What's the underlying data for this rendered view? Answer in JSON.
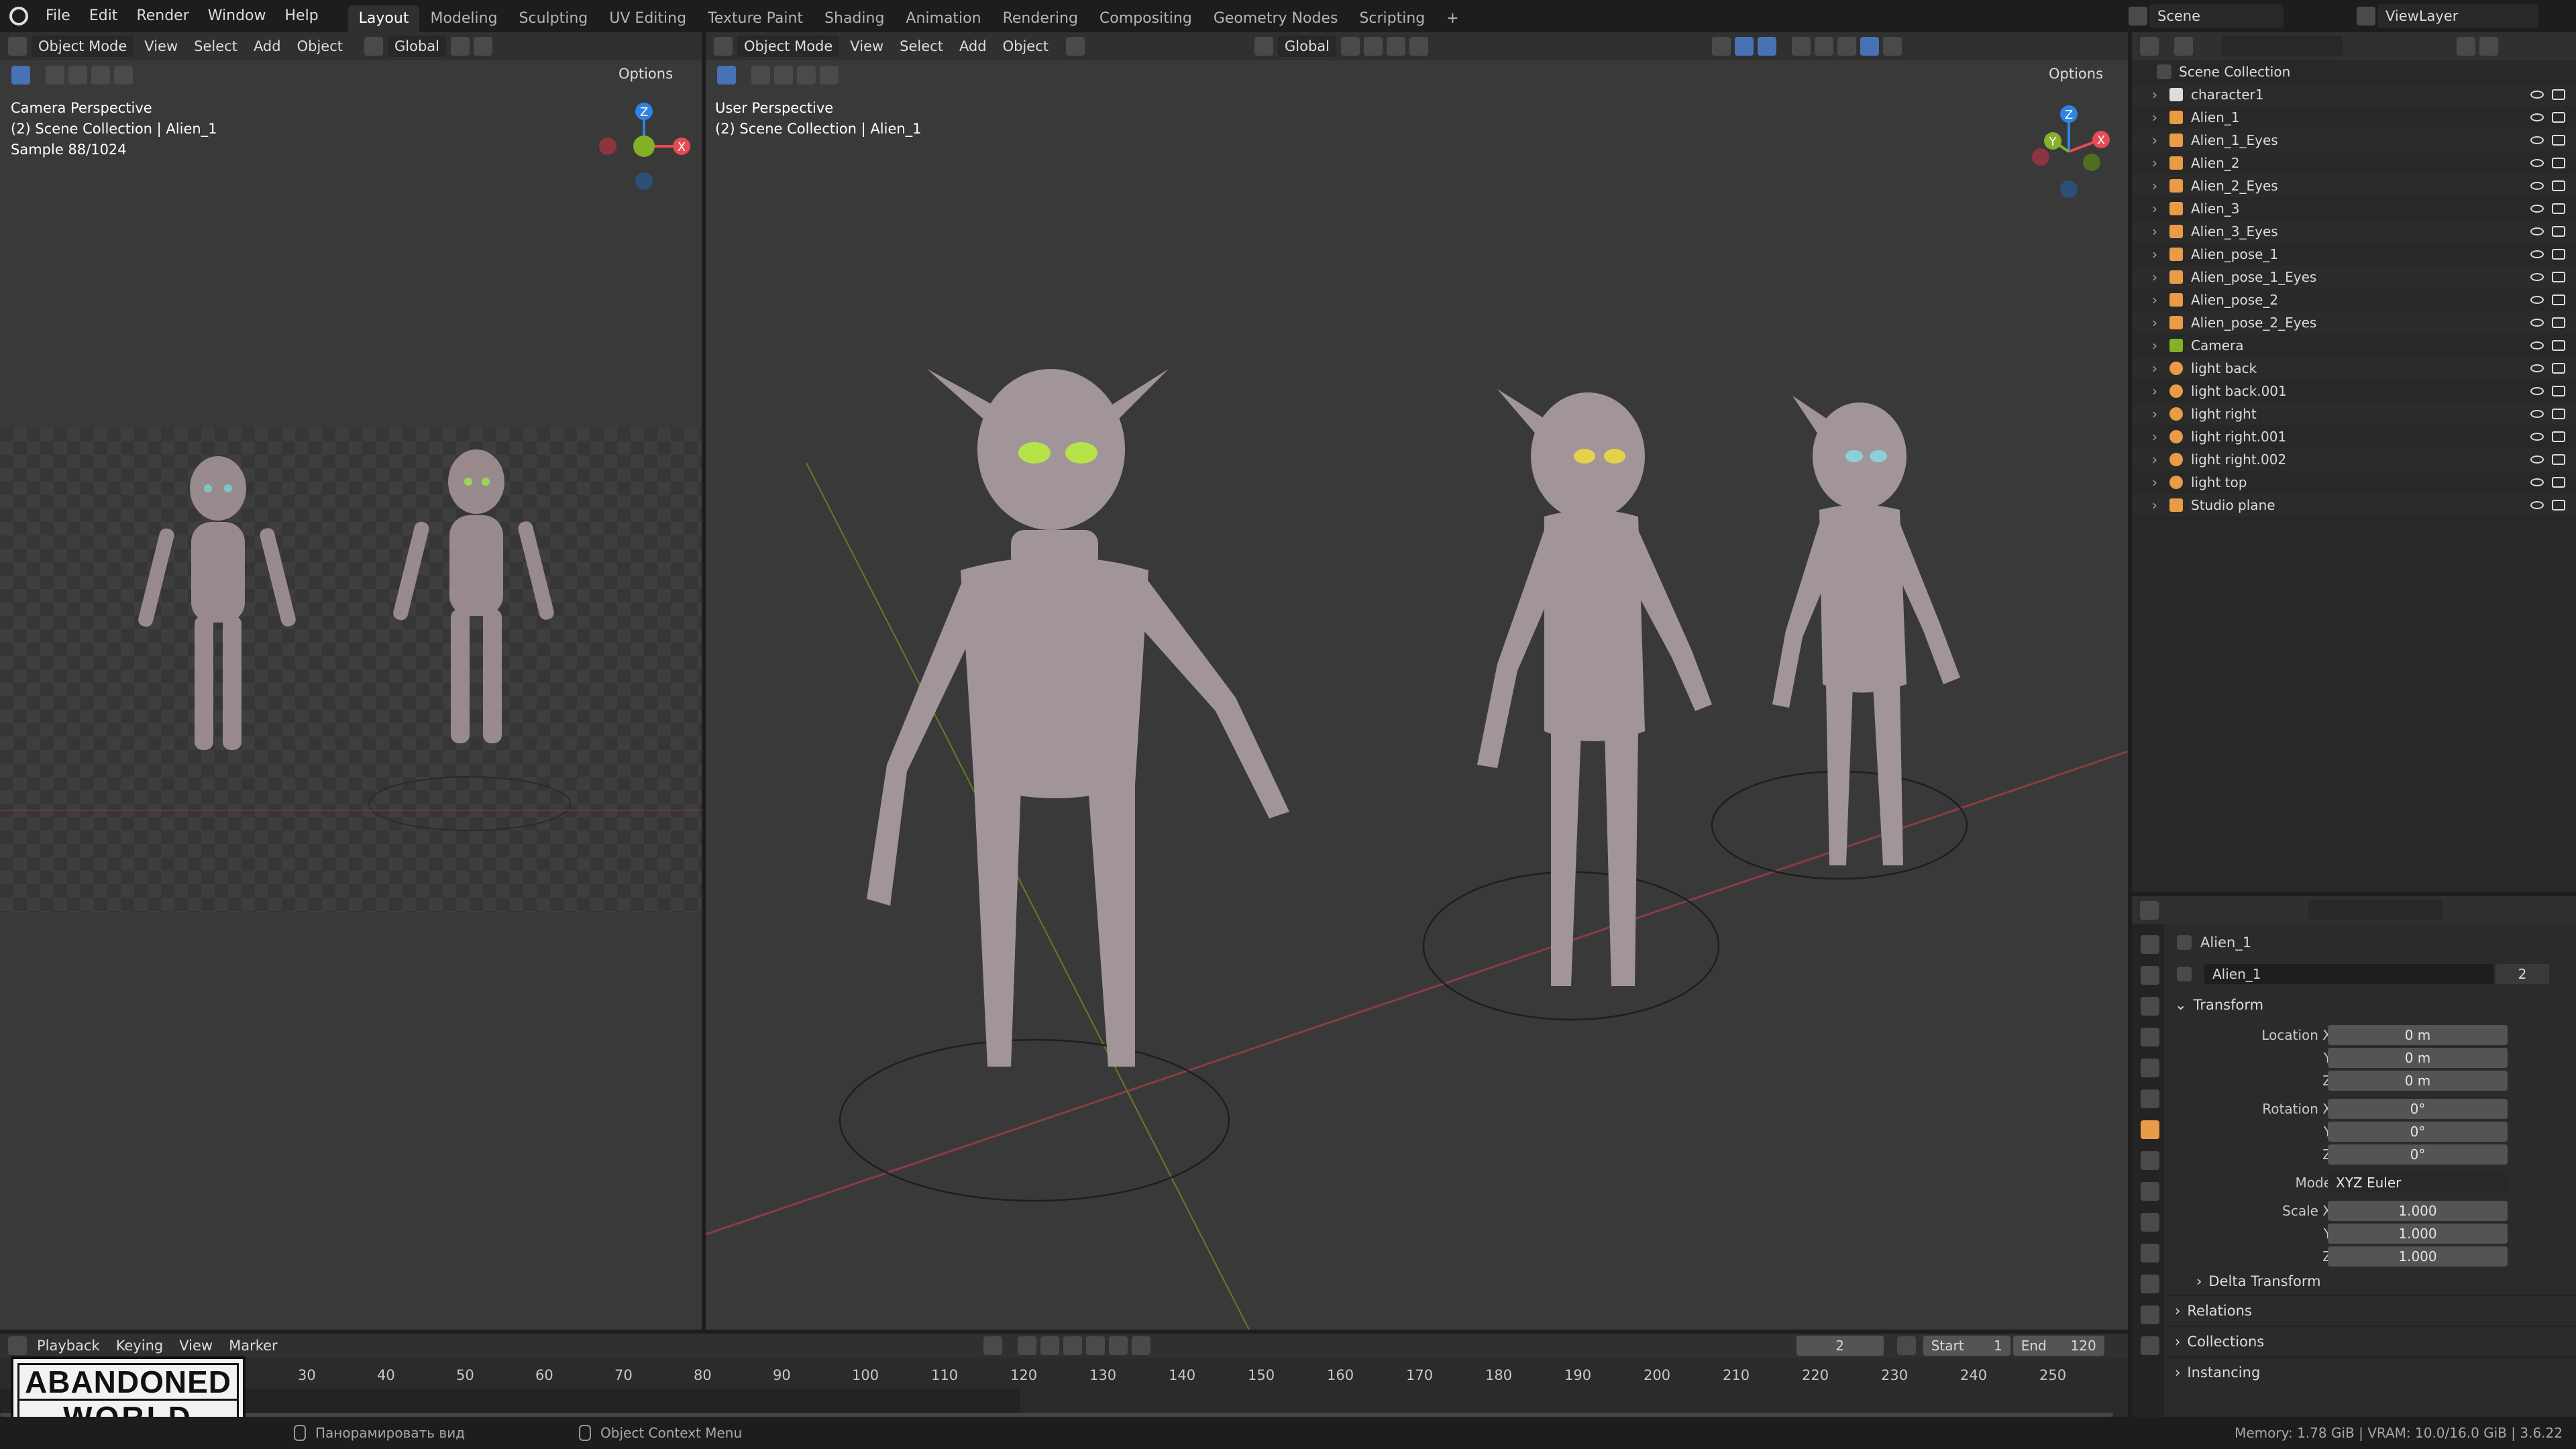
{
  "topbar": {
    "menus": [
      "File",
      "Edit",
      "Render",
      "Window",
      "Help"
    ],
    "workspaces": [
      "Layout",
      "Modeling",
      "Sculpting",
      "UV Editing",
      "Texture Paint",
      "Shading",
      "Animation",
      "Rendering",
      "Compositing",
      "Geometry Nodes",
      "Scripting"
    ],
    "active_workspace": "Layout",
    "add_tab": "+",
    "scene_label": "Scene",
    "viewlayer_label": "ViewLayer"
  },
  "left_view": {
    "mode": "Object Mode",
    "menus": [
      "View",
      "Select",
      "Add",
      "Object"
    ],
    "orientation": "Global",
    "options": "Options",
    "overlay_lines": [
      "Camera Perspective",
      "(2) Scene Collection | Alien_1",
      "Sample 88/1024"
    ]
  },
  "main_view": {
    "mode": "Object Mode",
    "menus": [
      "View",
      "Select",
      "Add",
      "Object"
    ],
    "orientation": "Global",
    "options": "Options",
    "overlay_lines": [
      "User Perspective",
      "(2) Scene Collection | Alien_1"
    ]
  },
  "gizmo_axes": {
    "x": "X",
    "y": "Y",
    "z": "Z"
  },
  "colors": {
    "x_axis": "#e44b55",
    "y_axis": "#84b128",
    "z_axis": "#2f83e3",
    "selected": "#4772b3",
    "object_orange": "#e99b46"
  },
  "outliner": {
    "root": "Scene Collection",
    "items": [
      {
        "name": "character1",
        "icon": "collection-icon"
      },
      {
        "name": "Alien_1",
        "icon": "mesh-icon"
      },
      {
        "name": "Alien_1_Eyes",
        "icon": "mesh-icon"
      },
      {
        "name": "Alien_2",
        "icon": "mesh-icon"
      },
      {
        "name": "Alien_2_Eyes",
        "icon": "mesh-icon"
      },
      {
        "name": "Alien_3",
        "icon": "mesh-icon"
      },
      {
        "name": "Alien_3_Eyes",
        "icon": "mesh-icon"
      },
      {
        "name": "Alien_pose_1",
        "icon": "mesh-icon"
      },
      {
        "name": "Alien_pose_1_Eyes",
        "icon": "mesh-icon"
      },
      {
        "name": "Alien_pose_2",
        "icon": "mesh-icon"
      },
      {
        "name": "Alien_pose_2_Eyes",
        "icon": "mesh-icon"
      },
      {
        "name": "Camera",
        "icon": "camera-icon"
      },
      {
        "name": "light back",
        "icon": "light-icon"
      },
      {
        "name": "light back.001",
        "icon": "light-icon"
      },
      {
        "name": "light right",
        "icon": "light-icon"
      },
      {
        "name": "light right.001",
        "icon": "light-icon"
      },
      {
        "name": "light right.002",
        "icon": "light-icon"
      },
      {
        "name": "light top",
        "icon": "light-icon"
      },
      {
        "name": "Studio plane",
        "icon": "mesh-icon"
      }
    ]
  },
  "properties": {
    "object_name": "Alien_1",
    "datablock_name": "Alien_1",
    "users": "2",
    "transform_label": "Transform",
    "location_label": "Location X",
    "rotation_label": "Rotation X",
    "scale_label": "Scale X",
    "axis_y": "Y",
    "axis_z": "Z",
    "location": [
      "0 m",
      "0 m",
      "0 m"
    ],
    "rotation": [
      "0°",
      "0°",
      "0°"
    ],
    "mode_label": "Mode",
    "mode_value": "XYZ Euler",
    "scale": [
      "1.000",
      "1.000",
      "1.000"
    ],
    "panels": [
      "Delta Transform",
      "Relations",
      "Collections",
      "Instancing"
    ]
  },
  "timeline": {
    "menus": [
      "Playback",
      "Keying",
      "View",
      "Marker"
    ],
    "current_frame": "2",
    "start_label": "Start",
    "start": "1",
    "end_label": "End",
    "end": "120",
    "ticks": [
      "30",
      "40",
      "50",
      "60",
      "70",
      "80",
      "90",
      "100",
      "110",
      "120",
      "130",
      "140",
      "150",
      "160",
      "170",
      "180",
      "190",
      "200",
      "210",
      "220",
      "230",
      "240",
      "250"
    ]
  },
  "statusbar": {
    "hint1": "Панорамировать вид",
    "hint2": "Object Context Menu",
    "stats": "Memory: 1.78 GiB | VRAM: 10.0/16.0 GiB | 3.6.22"
  },
  "watermark": {
    "line1": "ABANDONED",
    "line2": "WORLD"
  }
}
